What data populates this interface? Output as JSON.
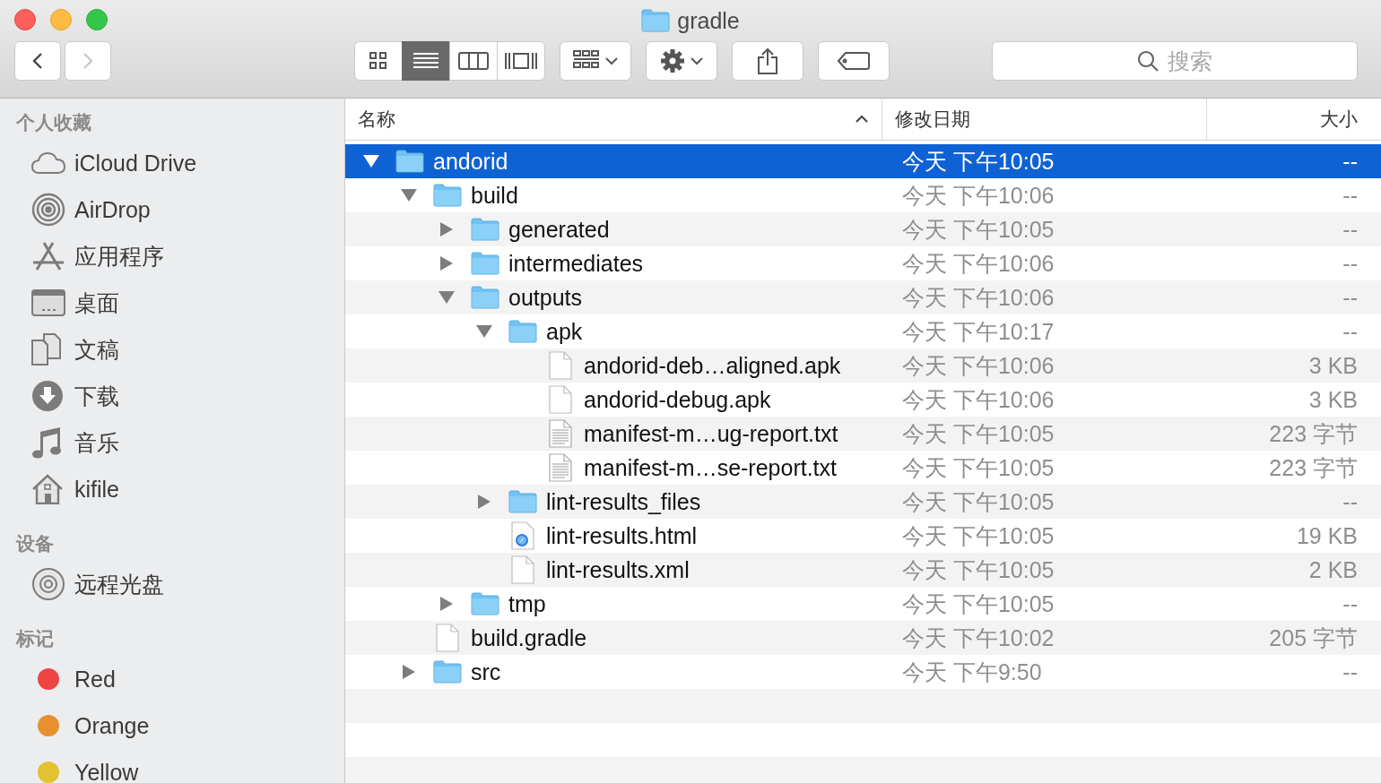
{
  "window": {
    "title": "gradle"
  },
  "toolbar": {
    "nav_buttons": [
      {
        "kind": "back",
        "disabled": false
      },
      {
        "kind": "forward",
        "disabled": true
      }
    ],
    "view_buttons": [
      {
        "kind": "icons",
        "selected": false
      },
      {
        "kind": "list",
        "selected": true
      },
      {
        "kind": "columns",
        "selected": false
      },
      {
        "kind": "coverflow",
        "selected": false
      }
    ],
    "search": {
      "placeholder": "搜索"
    }
  },
  "sidebar": {
    "sections": [
      {
        "title": "个人收藏",
        "items": [
          {
            "label": "iCloud Drive",
            "kind": "cloud"
          },
          {
            "label": "AirDrop",
            "kind": "airdrop"
          },
          {
            "label": "应用程序",
            "kind": "apps"
          },
          {
            "label": "桌面",
            "kind": "desktop"
          },
          {
            "label": "文稿",
            "kind": "documents"
          },
          {
            "label": "下载",
            "kind": "download"
          },
          {
            "label": "音乐",
            "kind": "music"
          },
          {
            "label": "kifile",
            "kind": "home"
          }
        ]
      },
      {
        "title": "设备",
        "items": [
          {
            "label": "远程光盘",
            "kind": "disc"
          }
        ]
      },
      {
        "title": "标记",
        "items": [
          {
            "label": "Red",
            "kind": "tag",
            "color": "#ee4444"
          },
          {
            "label": "Orange",
            "kind": "tag",
            "color": "#e8902f"
          },
          {
            "label": "Yellow",
            "kind": "tag",
            "color": "#e3c132"
          }
        ]
      }
    ]
  },
  "file_list": {
    "columns": [
      {
        "label": "名称",
        "sorted": true
      },
      {
        "label": "修改日期",
        "sorted": false
      },
      {
        "label": "大小",
        "sorted": false
      }
    ],
    "rows": [
      {
        "name": "andorid",
        "kind": "folder",
        "expanded": true,
        "selected": true,
        "modified": "今天 下午10:05",
        "size": "--",
        "children": [
          {
            "name": "build",
            "kind": "folder",
            "expanded": true,
            "selected": false,
            "modified": "今天 下午10:06",
            "size": "--",
            "children": [
              {
                "name": "generated",
                "kind": "folder",
                "expanded": false,
                "selected": false,
                "modified": "今天 下午10:05",
                "size": "--"
              },
              {
                "name": "intermediates",
                "kind": "folder",
                "expanded": false,
                "selected": false,
                "modified": "今天 下午10:06",
                "size": "--"
              },
              {
                "name": "outputs",
                "kind": "folder",
                "expanded": true,
                "selected": false,
                "modified": "今天 下午10:06",
                "size": "--",
                "children": [
                  {
                    "name": "apk",
                    "kind": "folder",
                    "expanded": true,
                    "selected": false,
                    "modified": "今天 下午10:17",
                    "size": "--",
                    "children": [
                      {
                        "name": "andorid-deb…aligned.apk",
                        "kind": "file",
                        "selected": false,
                        "modified": "今天 下午10:06",
                        "size": "3 KB"
                      },
                      {
                        "name": "andorid-debug.apk",
                        "kind": "file",
                        "selected": false,
                        "modified": "今天 下午10:06",
                        "size": "3 KB"
                      },
                      {
                        "name": "manifest-m…ug-report.txt",
                        "kind": "text",
                        "selected": false,
                        "modified": "今天 下午10:05",
                        "size": "223 字节"
                      },
                      {
                        "name": "manifest-m…se-report.txt",
                        "kind": "text",
                        "selected": false,
                        "modified": "今天 下午10:05",
                        "size": "223 字节"
                      }
                    ]
                  },
                  {
                    "name": "lint-results_files",
                    "kind": "folder",
                    "expanded": false,
                    "selected": false,
                    "modified": "今天 下午10:05",
                    "size": "--"
                  },
                  {
                    "name": "lint-results.html",
                    "kind": "html",
                    "selected": false,
                    "modified": "今天 下午10:05",
                    "size": "19 KB"
                  },
                  {
                    "name": "lint-results.xml",
                    "kind": "file",
                    "selected": false,
                    "modified": "今天 下午10:05",
                    "size": "2 KB"
                  }
                ]
              },
              {
                "name": "tmp",
                "kind": "folder",
                "expanded": false,
                "selected": false,
                "modified": "今天 下午10:05",
                "size": "--"
              }
            ]
          },
          {
            "name": "build.gradle",
            "kind": "file",
            "selected": false,
            "modified": "今天 下午10:02",
            "size": "205 字节"
          },
          {
            "name": "src",
            "kind": "folder",
            "expanded": false,
            "selected": false,
            "modified": "今天 下午9:50",
            "size": "--"
          }
        ]
      }
    ]
  }
}
